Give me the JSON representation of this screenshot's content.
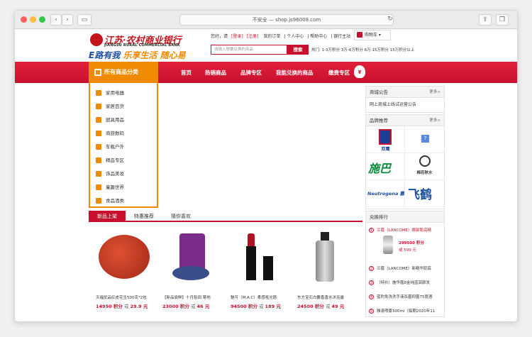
{
  "browser": {
    "url": "不安全 — shop.js96008.com",
    "back": "‹",
    "forward": "›"
  },
  "header": {
    "bank_name_cn": "江苏·农村商业银行",
    "bank_name_en": "JIANGSU RURAL COMMERCIAL BANK",
    "slogan_a": "E路有我",
    "slogan_b": "乐享生活 随心易",
    "links": {
      "welcome": "您好，请",
      "login": "[登录]",
      "register": "[注册]",
      "orders": "我的订单",
      "personal": "个人中心",
      "help": "帮助中心",
      "bank_site": "银行主站"
    },
    "cart_label": "购物车",
    "search_placeholder": "请输入想要兑换的商品",
    "search_button": "搜索",
    "hot_text": "热门: 1-3万积分 3万-6万积分 6万-15万积分 15万积分以上"
  },
  "nav": {
    "category_title": "所有商品分类",
    "items": [
      "首页",
      "热销商品",
      "品牌专区",
      "我能兑换的商品",
      "缴费专区"
    ],
    "bag_label": "¥"
  },
  "categories": [
    "家用电器",
    "家居百货",
    "厨具用品",
    "商旅数码",
    "车载户外",
    "精品专区",
    "饰品美妆",
    "童趣世界",
    "食品酒类"
  ],
  "notice": {
    "title": "商城公告",
    "more": "更多>",
    "items": [
      "网上商城上线试运营公告"
    ]
  },
  "brands": {
    "title": "品牌推荐",
    "more": "更多>",
    "logo_text": [
      "双鹰",
      "?",
      "施巴",
      "棉花秋水",
      "Neutrogena 露得清",
      "飞鹤"
    ]
  },
  "product_tabs": [
    "新品上架",
    "特惠推荐",
    "猜你喜欢"
  ],
  "products": [
    {
      "name": "天福优品红皮花生500克*2包",
      "points": "14950 积分",
      "or": "或",
      "cash": "29.9 元"
    },
    {
      "name": "【新品尝鲜】十月稻田 寒地",
      "points": "23000 积分",
      "or": "或",
      "cash": "46 元"
    },
    {
      "name": "魅可（M.A.C）柔感哑光唇",
      "points": "94500 积分",
      "or": "或",
      "cash": "189 元"
    },
    {
      "name": "东方宝石白麝香香水沐浴露",
      "points": "24500 积分",
      "or": "或",
      "cash": "49 元"
    }
  ],
  "ranking": {
    "title": "兑换排行",
    "top": {
      "name": "兰蔻（LANCOME）眼部肌底精",
      "points": "299500 积分",
      "cash": "或 599 元"
    },
    "rows": [
      {
        "num": "1",
        "name": "兰蔻（LANCOME）眼部肌底精"
      },
      {
        "num": "2",
        "name": "兰蔻（LANCOME）新精华肌底"
      },
      {
        "num": "3",
        "name": "（特价）施华蔻8金纯蓝润颜发"
      },
      {
        "num": "4",
        "name": "蓝豹免洗洗手液杀菌抑菌75度酒"
      },
      {
        "num": "5",
        "name": "雅漾喷雾300ml（临期2020年11"
      }
    ]
  },
  "colors": {
    "brand_red": "#c8102e",
    "accent_orange": "#f08a00"
  }
}
